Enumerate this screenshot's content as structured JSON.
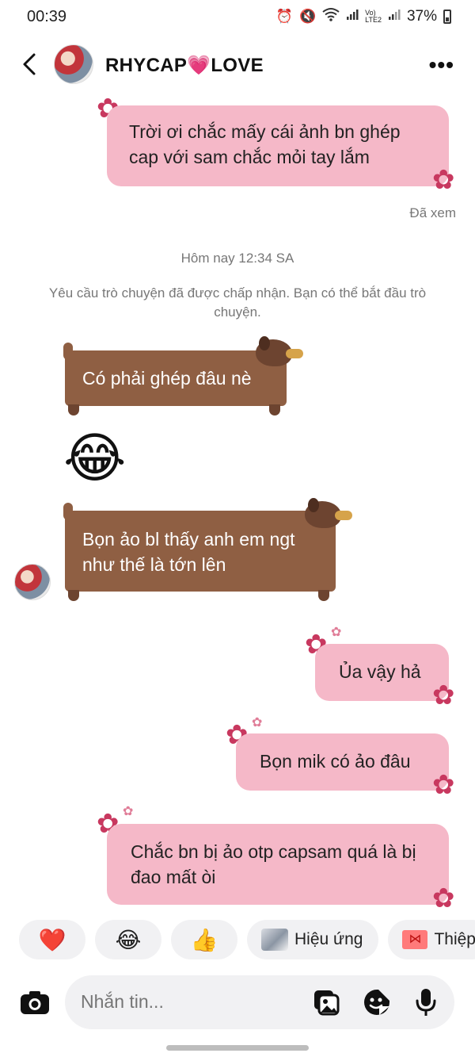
{
  "status_bar": {
    "time": "00:39",
    "volte_label": "Vo)",
    "lte_label": "LTE2",
    "battery": "37%"
  },
  "header": {
    "title_part1": "RHYCAP",
    "title_heart": "💗",
    "title_part2": "LOVE"
  },
  "messages": {
    "out_1": "Trời ơi chắc mấy cái ảnh bn ghép cap với sam chắc mỏi tay lắm",
    "seen": "Đã xem",
    "timestamp": "Hôm nay 12:34 SA",
    "notice": "Yêu cầu trò chuyện đã được chấp nhận. Bạn có thể bắt đầu trò chuyện.",
    "in_1": "Có phải ghép đâu nè",
    "in_emoji": "😂",
    "in_2": "Bọn ảo bl thấy anh em ngt như thế là tớn lên",
    "out_2": "Ủa vậy hả",
    "out_3": "Bọn mik có ảo đâu",
    "out_4": "Chắc bn bị ảo otp capsam quá là bị đao mất òi"
  },
  "quick_replies": {
    "heart": "❤️",
    "laugh": "😂",
    "thumbs": "👍",
    "effects": "Hiệu ứng",
    "cards": "Thiệp"
  },
  "composer": {
    "placeholder": "Nhắn tin..."
  },
  "colors": {
    "outgoing_bubble": "#f5b8c8",
    "incoming_bubble": "#8f5f43",
    "flower": "#c8385f"
  }
}
